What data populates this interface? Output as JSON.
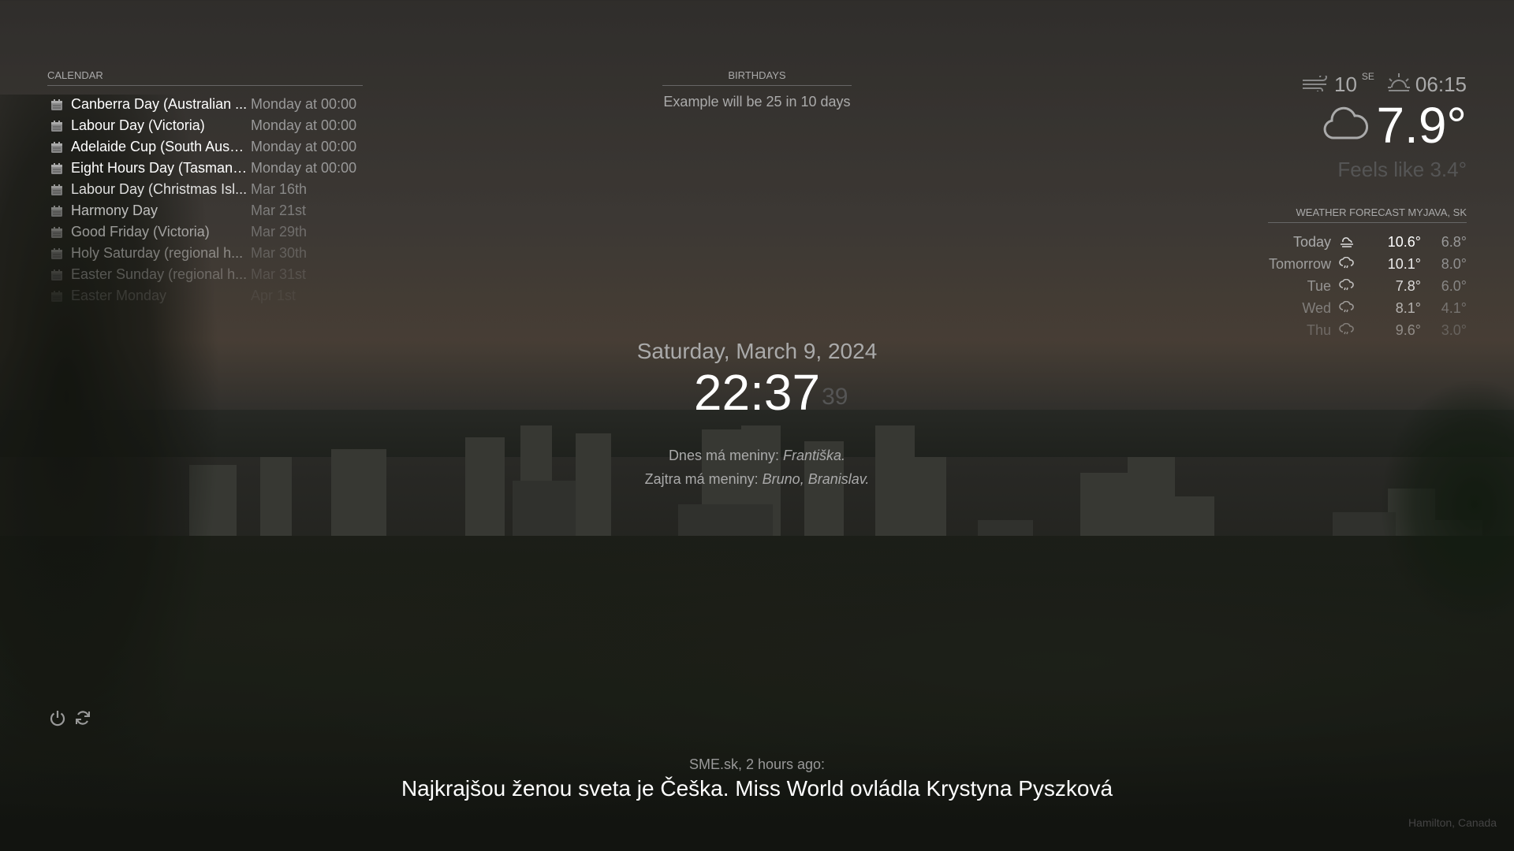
{
  "calendar": {
    "header": "CALENDAR",
    "events": [
      {
        "title": "Canberra Day (Australian ...",
        "time": "Monday at 00:00",
        "opacity": 1
      },
      {
        "title": "Labour Day (Victoria)",
        "time": "Monday at 00:00",
        "opacity": 1
      },
      {
        "title": "Adelaide Cup (South Austr...",
        "time": "Monday at 00:00",
        "opacity": 1
      },
      {
        "title": "Eight Hours Day (Tasmania...",
        "time": "Monday at 00:00",
        "opacity": 1
      },
      {
        "title": "Labour Day (Christmas Isl...",
        "time": "Mar 16th",
        "opacity": 0.85
      },
      {
        "title": "Harmony Day",
        "time": "Mar 21st",
        "opacity": 0.7
      },
      {
        "title": "Good Friday (Victoria)",
        "time": "Mar 29th",
        "opacity": 0.55
      },
      {
        "title": "Holy Saturday (regional h...",
        "time": "Mar 30th",
        "opacity": 0.4
      },
      {
        "title": "Easter Sunday (regional h...",
        "time": "Mar 31st",
        "opacity": 0.25
      },
      {
        "title": "Easter Monday",
        "time": "Apr 1st",
        "opacity": 0.12
      }
    ]
  },
  "birthdays": {
    "header": "BIRTHDAYS",
    "text": "Example will be 25 in 10 days"
  },
  "weather": {
    "wind_speed": "10",
    "wind_dir": "SE",
    "sunrise": "06:15",
    "temperature": "7.9°",
    "feels_like": "Feels like 3.4°",
    "icon": "cloud-icon"
  },
  "forecast": {
    "header": "WEATHER FORECAST MYJAVA, SK",
    "days": [
      {
        "day": "Today",
        "icon": "fog-icon",
        "max": "10.6°",
        "min": "6.8°",
        "opacity": 1
      },
      {
        "day": "Tomorrow",
        "icon": "rain-icon",
        "max": "10.1°",
        "min": "8.0°",
        "opacity": 0.9
      },
      {
        "day": "Tue",
        "icon": "rain-icon",
        "max": "7.8°",
        "min": "6.0°",
        "opacity": 0.8
      },
      {
        "day": "Wed",
        "icon": "rain-icon",
        "max": "8.1°",
        "min": "4.1°",
        "opacity": 0.6
      },
      {
        "day": "Thu",
        "icon": "rain-icon",
        "max": "9.6°",
        "min": "3.0°",
        "opacity": 0.4
      }
    ]
  },
  "clock": {
    "date": "Saturday, March 9, 2024",
    "time": "22:37",
    "seconds": "39"
  },
  "namedays": {
    "today_label": "Dnes má meniny:",
    "today_names": "Františka.",
    "tomorrow_label": "Zajtra má meniny:",
    "tomorrow_names": "Bruno, Branislav."
  },
  "news": {
    "source": "SME.sk, 2 hours ago:",
    "title": "Najkrajšou ženou sveta je Češka. Miss World ovládla Krystyna Pyszková"
  },
  "background": {
    "location": "Hamilton, Canada"
  }
}
